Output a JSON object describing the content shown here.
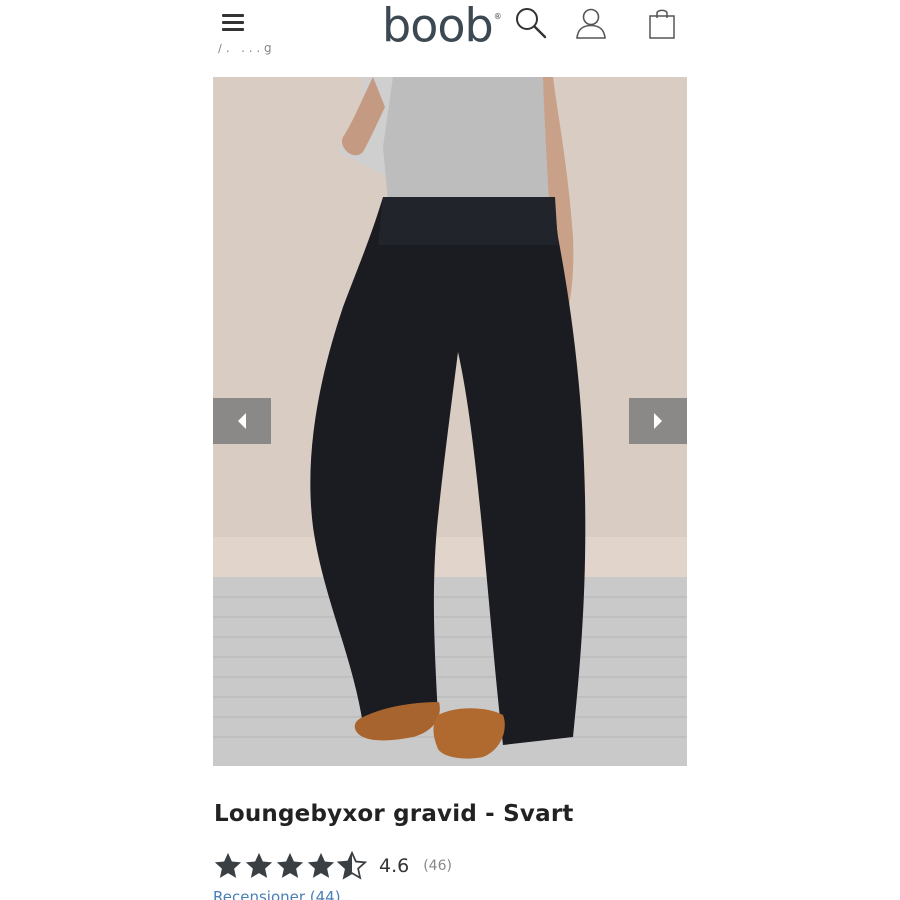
{
  "header": {
    "logo_text": "boob",
    "logo_mark": "®",
    "icons": [
      "menu-icon",
      "search-icon",
      "user-icon",
      "shopping-bag-icon"
    ]
  },
  "gallery": {
    "prev_icon": "chevron-left-icon",
    "next_icon": "chevron-right-icon"
  },
  "product": {
    "title": "Loungebyxor gravid - Svart",
    "rating": {
      "value": 4.6,
      "value_text": "4.6",
      "count_text": "(46)",
      "stars_max": 5
    },
    "reviews_link": "Recensioner (44)"
  },
  "colors": {
    "logo": "#3c4852",
    "link": "#4a7fb5",
    "star": "#3a3f44",
    "arrow_bg": "#7d7d7d"
  }
}
